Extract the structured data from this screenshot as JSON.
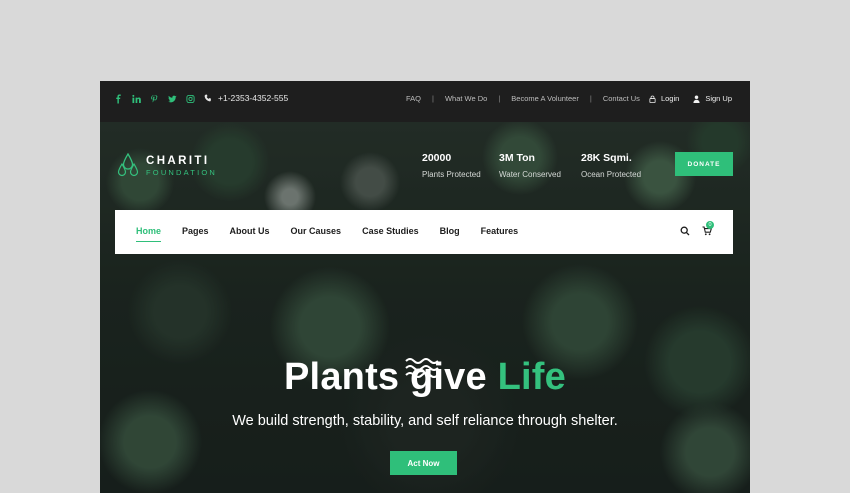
{
  "topbar": {
    "social_icons": [
      "facebook-icon",
      "linkedin-icon",
      "pinterest-icon",
      "twitter-icon",
      "instagram-icon"
    ],
    "phone": "+1-2353-4352-555",
    "links": [
      "FAQ",
      "What We Do",
      "Become A Volunteer",
      "Contact Us"
    ],
    "login": "Login",
    "signup": "Sign Up"
  },
  "logo": {
    "name": "CHARITI",
    "sub": "FOUNDATION"
  },
  "stats": [
    {
      "value": "20000",
      "label": "Plants Protected"
    },
    {
      "value": "3M Ton",
      "label": "Water Conserved"
    },
    {
      "value": "28K Sqmi.",
      "label": "Ocean Protected"
    }
  ],
  "donate_label": "DONATE",
  "nav": {
    "items": [
      "Home",
      "Pages",
      "About Us",
      "Our Causes",
      "Case Studies",
      "Blog",
      "Features"
    ],
    "active": "Home",
    "cart_count": "0"
  },
  "hero": {
    "headline_main": "Plants give ",
    "headline_accent": "Life",
    "tagline": "We build strength, stability, and self reliance through shelter.",
    "cta": "Act Now"
  },
  "colors": {
    "accent": "#2fbf7a",
    "topbar": "#1e1e1e",
    "nav_bg": "#ffffff"
  }
}
